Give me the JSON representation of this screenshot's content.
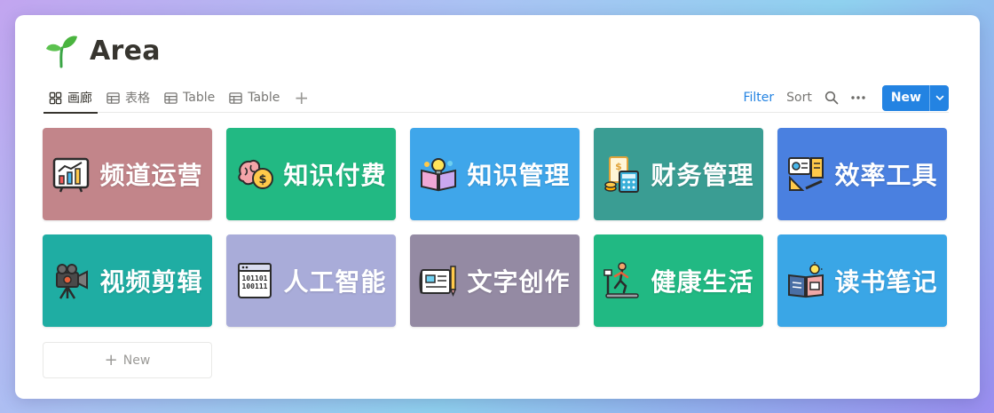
{
  "page": {
    "title": "Area",
    "icon": "sprout-icon"
  },
  "tabs": [
    {
      "label": "画廊",
      "icon": "gallery-icon",
      "active": true
    },
    {
      "label": "表格",
      "icon": "table-icon",
      "active": false
    },
    {
      "label": "Table",
      "icon": "table-icon",
      "active": false
    },
    {
      "label": "Table",
      "icon": "table-icon",
      "active": false
    }
  ],
  "toolbar": {
    "add_view": "+",
    "filter_label": "Filter",
    "sort_label": "Sort",
    "new_label": "New"
  },
  "cards": [
    {
      "label": "频道运营",
      "icon": "chart-board-icon",
      "color": "#c2858a"
    },
    {
      "label": "知识付费",
      "icon": "brain-coin-icon",
      "color": "#22b983"
    },
    {
      "label": "知识管理",
      "icon": "book-bulb-icon",
      "color": "#3fa6ea"
    },
    {
      "label": "财务管理",
      "icon": "calculator-icon",
      "color": "#3a9d93"
    },
    {
      "label": "效率工具",
      "icon": "tools-icon",
      "color": "#4a80e0"
    },
    {
      "label": "视频剪辑",
      "icon": "video-camera-icon",
      "color": "#1fada3"
    },
    {
      "label": "人工智能",
      "icon": "binary-icon",
      "color": "#a9acd9"
    },
    {
      "label": "文字创作",
      "icon": "writing-icon",
      "color": "#948aa3"
    },
    {
      "label": "健康生活",
      "icon": "treadmill-icon",
      "color": "#21b983"
    },
    {
      "label": "读书笔记",
      "icon": "reading-icon",
      "color": "#3aa6e6"
    }
  ],
  "new_card": {
    "label": "New"
  }
}
